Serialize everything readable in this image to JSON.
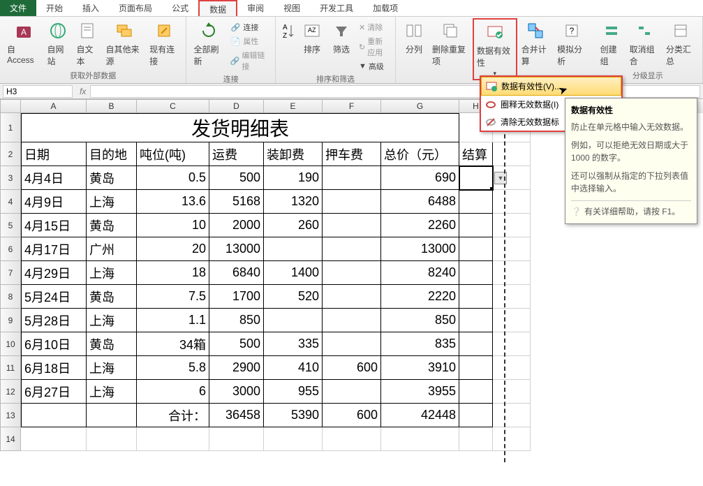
{
  "tabs": {
    "file": "文件",
    "home": "开始",
    "insert": "插入",
    "layout": "页面布局",
    "formula": "公式",
    "data": "数据",
    "review": "审阅",
    "view": "视图",
    "dev": "开发工具",
    "addin": "加载项"
  },
  "ribbon": {
    "ext": {
      "access": "自 Access",
      "web": "自网站",
      "text": "自文本",
      "other": "自其他来源",
      "existing": "现有连接",
      "label": "获取外部数据"
    },
    "conn": {
      "refresh": "全部刷新",
      "connections": "连接",
      "props": "属性",
      "editlinks": "编辑链接",
      "label": "连接"
    },
    "sort": {
      "sort": "排序",
      "filter": "筛选",
      "clear": "清除",
      "reapply": "重新应用",
      "advanced": "高级",
      "label": "排序和筛选"
    },
    "tools": {
      "t2c": "分列",
      "dup": "删除重复项",
      "dv": "数据有效性",
      "consolidate": "合并计算",
      "whatif": "模拟分析"
    },
    "outline": {
      "group": "创建组",
      "ungroup": "取消组合",
      "subtotal": "分类汇总",
      "label": "分级显示"
    }
  },
  "menu": {
    "dv": "数据有效性(V)...",
    "circle": "圈释无效数据(I)",
    "clear": "清除无效数据标"
  },
  "tooltip": {
    "title": "数据有效性",
    "p1": "防止在单元格中输入无效数据。",
    "p2": "例如，可以拒绝无效日期或大于 1000 的数字。",
    "p3": "还可以强制从指定的下拉列表值中选择输入。",
    "help": "有关详细帮助，请按 F1。"
  },
  "namebox": "H3",
  "cols": {
    "A": 94,
    "B": 72,
    "C": 104,
    "D": 78,
    "E": 84,
    "F": 84,
    "G": 112,
    "H": 48,
    "I": 54
  },
  "title": "发货明细表",
  "headers": {
    "A": "日期",
    "B": "目的地",
    "C": "吨位(吨)",
    "D": "运费",
    "E": "装卸费",
    "F": "押车费",
    "G": "总价（元）",
    "H": "结算"
  },
  "rows": [
    {
      "A": "4月4日",
      "B": "黄岛",
      "C": "0.5",
      "D": "500",
      "E": "190",
      "F": "",
      "G": "690"
    },
    {
      "A": "4月9日",
      "B": "上海",
      "C": "13.6",
      "D": "5168",
      "E": "1320",
      "F": "",
      "G": "6488"
    },
    {
      "A": "4月15日",
      "B": "黄岛",
      "C": "10",
      "D": "2000",
      "E": "260",
      "F": "",
      "G": "2260"
    },
    {
      "A": "4月17日",
      "B": "广州",
      "C": "20",
      "D": "13000",
      "E": "",
      "F": "",
      "G": "13000"
    },
    {
      "A": "4月29日",
      "B": "上海",
      "C": "18",
      "D": "6840",
      "E": "1400",
      "F": "",
      "G": "8240"
    },
    {
      "A": "5月24日",
      "B": "黄岛",
      "C": "7.5",
      "D": "1700",
      "E": "520",
      "F": "",
      "G": "2220"
    },
    {
      "A": "5月28日",
      "B": "上海",
      "C": "1.1",
      "D": "850",
      "E": "",
      "F": "",
      "G": "850"
    },
    {
      "A": "6月10日",
      "B": "黄岛",
      "C": "34箱",
      "D": "500",
      "E": "335",
      "F": "",
      "G": "835"
    },
    {
      "A": "6月18日",
      "B": "上海",
      "C": "5.8",
      "D": "2900",
      "E": "410",
      "F": "600",
      "G": "3910"
    },
    {
      "A": "6月27日",
      "B": "上海",
      "C": "6",
      "D": "3000",
      "E": "955",
      "F": "",
      "G": "3955"
    }
  ],
  "total": {
    "label": "合计：",
    "D": "36458",
    "E": "5390",
    "F": "600",
    "G": "42448"
  }
}
